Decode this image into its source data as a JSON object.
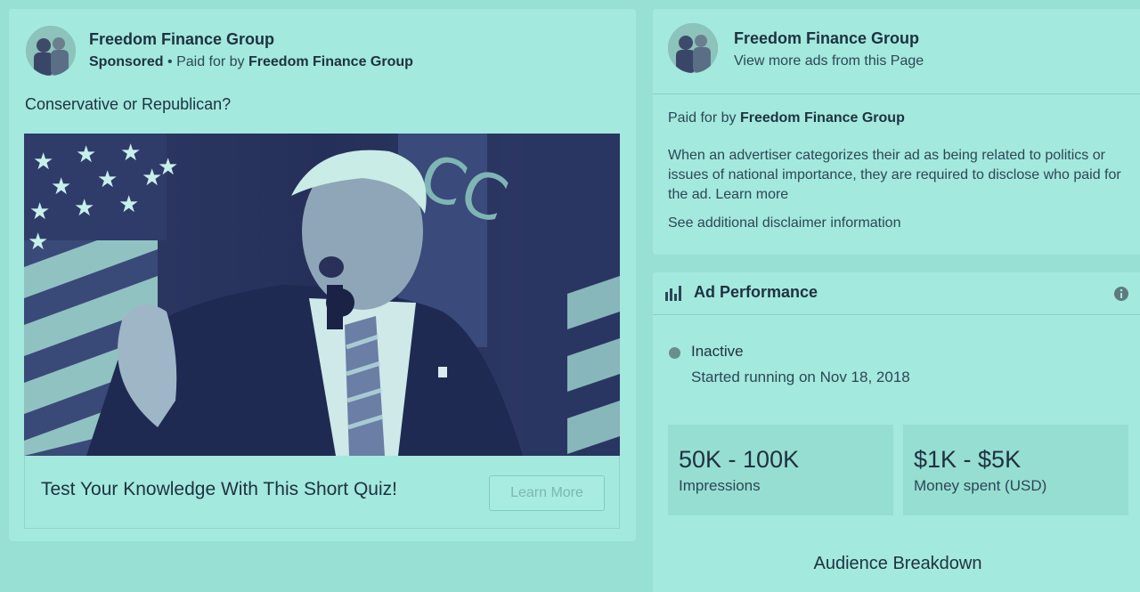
{
  "ad": {
    "page_name": "Freedom Finance Group",
    "sponsored_label": "Sponsored",
    "separator": " • ",
    "paid_for_prefix": "Paid for by ",
    "paid_for_name": "Freedom Finance Group",
    "text": "Conservative or Republican?",
    "headline": "Test Your Knowledge With This Short Quiz!",
    "cta_label": "Learn More",
    "image_icon": "campaign-photo-image",
    "avatar_icon": "page-avatar-image"
  },
  "info": {
    "page_name": "Freedom Finance Group",
    "view_more_link": "View more ads from this Page",
    "paid_for_prefix": "Paid for by ",
    "paid_for_name": "Freedom Finance Group",
    "disclosure_text": "When an advertiser categorizes their ad as being related to politics or issues of national importance, they are required to disclose who paid for the ad. ",
    "learn_more_link": "Learn more",
    "disclaimer_link": "See additional disclaimer information"
  },
  "performance": {
    "title": "Ad Performance",
    "title_icon": "bar-chart-icon",
    "info_icon": "info-icon",
    "status": "Inactive",
    "status_color": "#6a8e8a",
    "started": "Started running on Nov 18, 2018",
    "impressions_value": "50K - 100K",
    "impressions_label": "Impressions",
    "spend_value": "$1K - $5K",
    "spend_label": "Money spent (USD)",
    "audience_title": "Audience Breakdown"
  },
  "colors": {
    "background": "#98e0d4",
    "card": "#a3e9de",
    "text": "#1f3140",
    "image_tint": "#2a3560"
  }
}
